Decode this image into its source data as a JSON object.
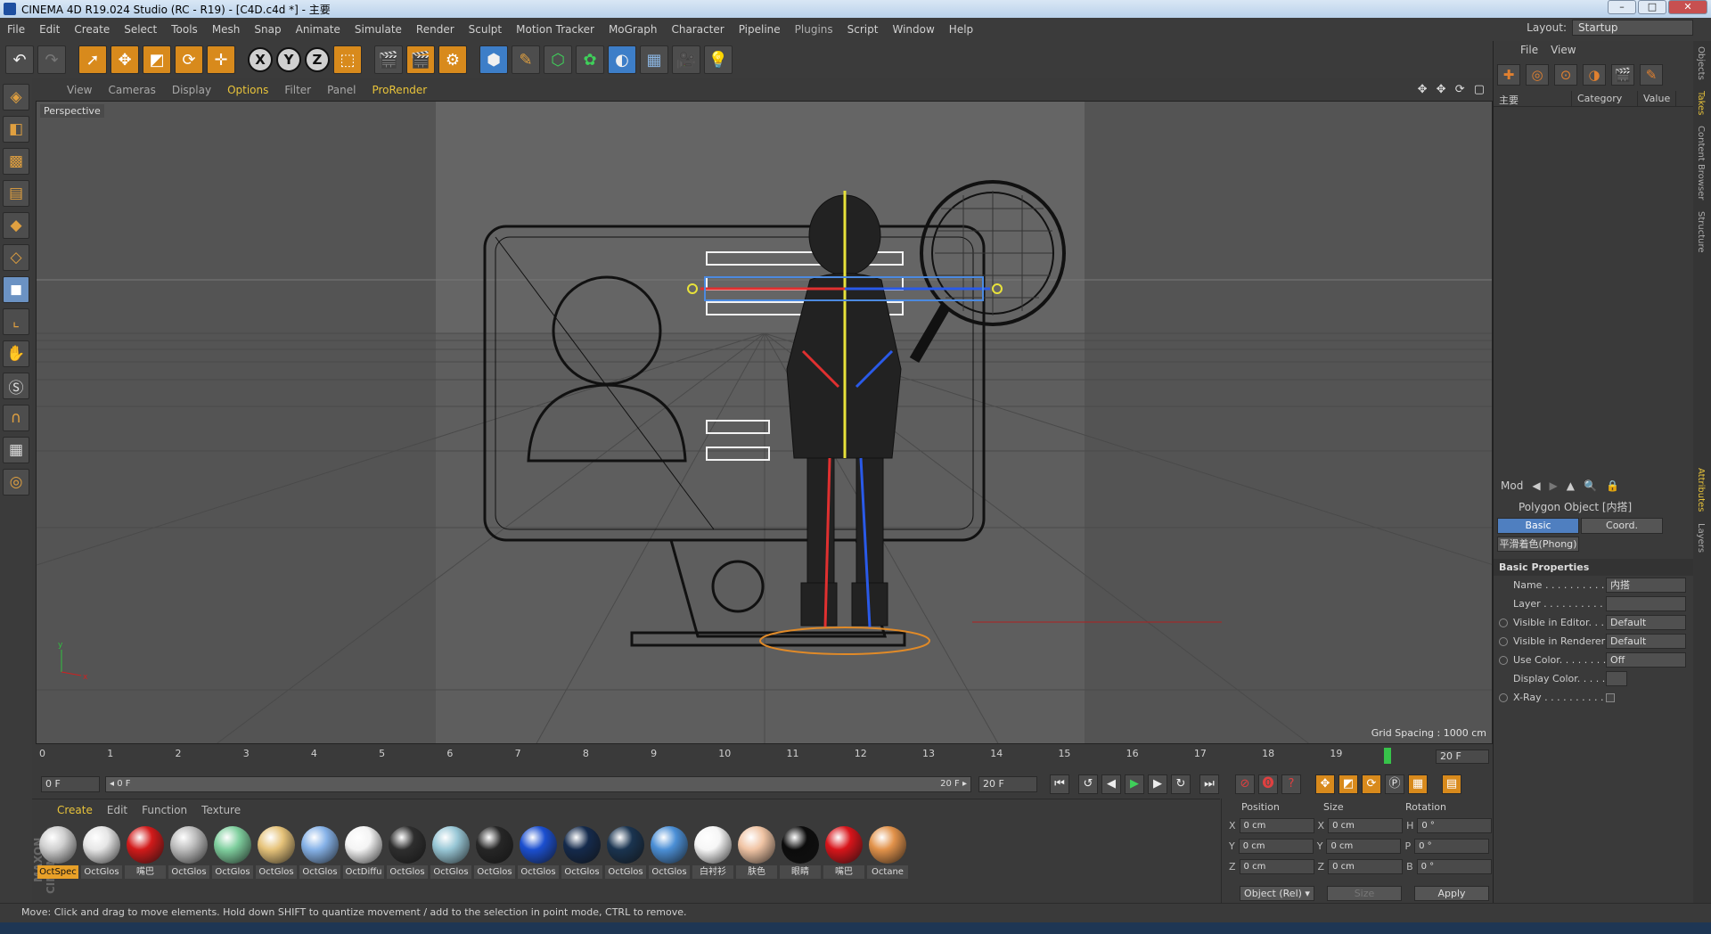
{
  "window": {
    "title": "CINEMA 4D R19.024 Studio (RC - R19) - [C4D.c4d *] - 主要",
    "minimize": "–",
    "maximize": "□",
    "close": "✕"
  },
  "menu": {
    "items": [
      "File",
      "Edit",
      "Create",
      "Select",
      "Tools",
      "Mesh",
      "Snap",
      "Animate",
      "Simulate",
      "Render",
      "Sculpt",
      "Motion Tracker",
      "MoGraph",
      "Character",
      "Pipeline",
      "Plugins",
      "Script",
      "Window",
      "Help"
    ],
    "layout_label": "Layout:",
    "layout_value": "Startup"
  },
  "viewport": {
    "menu": [
      "View",
      "Cameras",
      "Display",
      "Options",
      "Filter",
      "Panel",
      "ProRender"
    ],
    "label": "Perspective",
    "grid_spacing": "Grid Spacing : 1000 cm",
    "icons": "✥ ✥ ⟳ ▢"
  },
  "timeline": {
    "ticks": [
      "0",
      "1",
      "2",
      "3",
      "4",
      "5",
      "6",
      "7",
      "8",
      "9",
      "10",
      "11",
      "12",
      "13",
      "14",
      "15",
      "16",
      "17",
      "18",
      "19"
    ],
    "current_frame": "20 F",
    "marker_frame": 19.8
  },
  "transport": {
    "start": "0 F",
    "slider_left": "◂ 0 F",
    "slider_right": "20 F ▸",
    "end": "20 F"
  },
  "materials": {
    "menu": [
      "Create",
      "Edit",
      "Function",
      "Texture"
    ],
    "logo": "MAXON CINEMA 4D",
    "items": [
      {
        "label": "OctSpec",
        "color": "#cfcfcf"
      },
      {
        "label": "OctGlos",
        "color": "#e6e6e6"
      },
      {
        "label": "嘴巴",
        "color": "#d21a1a"
      },
      {
        "label": "OctGlos",
        "color": "#bdbdbd"
      },
      {
        "label": "OctGlos",
        "color": "#7fcf9e"
      },
      {
        "label": "OctGlos",
        "color": "#e6c37a"
      },
      {
        "label": "OctGlos",
        "color": "#86b2e8"
      },
      {
        "label": "OctDiffu",
        "color": "#f4f4f4"
      },
      {
        "label": "OctGlos",
        "color": "#2e2e2e"
      },
      {
        "label": "OctGlos",
        "color": "#98c7d6"
      },
      {
        "label": "OctGlos",
        "color": "#262626"
      },
      {
        "label": "OctGlos",
        "color": "#1b4fd0"
      },
      {
        "label": "OctGlos",
        "color": "#142a4c"
      },
      {
        "label": "OctGlos",
        "color": "#1a3450"
      },
      {
        "label": "OctGlos",
        "color": "#4b8fd6"
      },
      {
        "label": "白衬衫",
        "color": "#f6f6f6"
      },
      {
        "label": "肤色",
        "color": "#f0c4a4"
      },
      {
        "label": "眼睛",
        "color": "#0c0c0c"
      },
      {
        "label": "嘴巴",
        "color": "#d8141a"
      },
      {
        "label": "Octane",
        "color": "#e2924a"
      }
    ]
  },
  "coords": {
    "headers": [
      "Position",
      "Size",
      "Rotation"
    ],
    "rows": [
      {
        "axis": "X",
        "pos": "0 cm",
        "size_axis": "X",
        "size": "0 cm",
        "rot_axis": "H",
        "rot": "0 °"
      },
      {
        "axis": "Y",
        "pos": "0 cm",
        "size_axis": "Y",
        "size": "0 cm",
        "rot_axis": "P",
        "rot": "0 °"
      },
      {
        "axis": "Z",
        "pos": "0 cm",
        "size_axis": "Z",
        "size": "0 cm",
        "rot_axis": "B",
        "rot": "0 °"
      }
    ],
    "object_mode": "Object (Rel) ▾",
    "size_mode": "Size",
    "apply": "Apply"
  },
  "objects_panel": {
    "menu": [
      "File",
      "View"
    ],
    "columns": [
      "主要",
      "Category",
      "Value"
    ]
  },
  "attributes": {
    "menu": "Mod",
    "title": "Polygon Object [内搭]",
    "tabs": [
      "Basic",
      "Coord."
    ],
    "phong_tab": "平滑着色(Phong)",
    "section": "Basic Properties",
    "rows": [
      {
        "label": "Name . . . . . . . . . . .",
        "value": "内搭",
        "radio": false
      },
      {
        "label": "Layer . . . . . . . . . . .",
        "value": "",
        "radio": false
      },
      {
        "label": "Visible in Editor. . .",
        "value": "Default",
        "radio": true
      },
      {
        "label": "Visible in Renderer",
        "value": "Default",
        "radio": true
      },
      {
        "label": "Use Color. . . . . . . .",
        "value": "Off",
        "radio": true
      },
      {
        "label": "Display Color. . . . .",
        "value": "",
        "radio": false
      },
      {
        "label": "X-Ray . . . . . . . . . .",
        "value": "",
        "radio": true
      }
    ]
  },
  "side_tabs": [
    "Objects",
    "Takes",
    "Content Browser",
    "Structure",
    "Attributes",
    "Layers"
  ],
  "status": "Move: Click and drag to move elements. Hold down SHIFT to quantize movement / add to the selection in point mode, CTRL to remove.",
  "colors": {
    "accent": "#e8c33a",
    "selection": "#4f7fc0",
    "axis_x": "#d02020",
    "axis_y": "#30c040"
  }
}
